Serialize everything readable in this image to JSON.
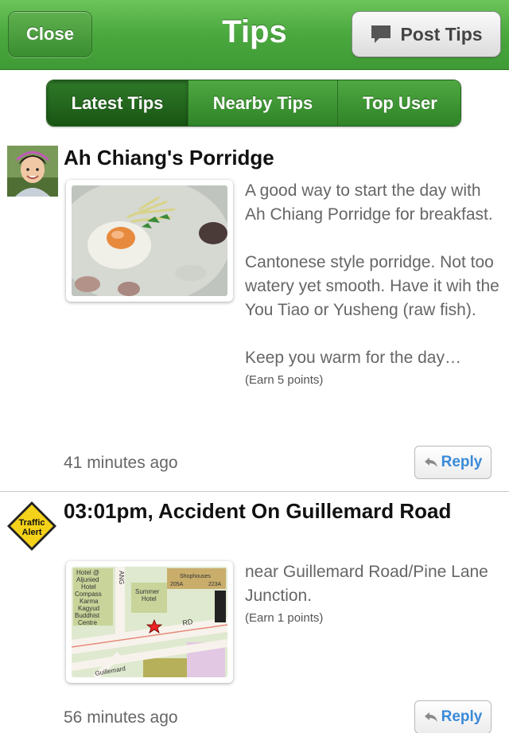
{
  "navbar": {
    "title": "Tips",
    "close_label": "Close",
    "post_label": "Post Tips"
  },
  "tabs": [
    {
      "label": "Latest Tips",
      "active": true
    },
    {
      "label": "Nearby Tips",
      "active": false
    },
    {
      "label": "Top User",
      "active": false
    }
  ],
  "tips": [
    {
      "title": "Ah Chiang's Porridge",
      "paragraphs": [
        "A good way to start the day with Ah Chiang Porridge for breakfast.",
        "Cantonese style porridge. Not too watery yet smooth. Have it wih the You Tiao or Yusheng (raw fish).",
        "Keep you warm for the day…"
      ],
      "earn": "(Earn 5 points)",
      "time": "41 minutes ago",
      "reply_label": "Reply",
      "icon": "user-avatar",
      "image": "porridge-photo"
    },
    {
      "title": "03:01pm, Accident On Guillemard Road",
      "paragraphs": [
        "near Guillemard Road/Pine Lane Junction."
      ],
      "earn": "(Earn 1 points)",
      "time": "56 minutes ago",
      "reply_label": "Reply",
      "icon": "traffic-alert-sign",
      "sign_text": [
        "Traffic",
        "Alert"
      ],
      "image": "map-thumbnail",
      "map_labels": {
        "hotel": [
          "Hotel @",
          "Aljunied",
          "Hotel"
        ],
        "summer": [
          "Summer",
          "Hotel"
        ],
        "shophouses": "Shophouses",
        "lot_a": "205A",
        "lot_b": "223A",
        "temple": [
          "Compass",
          "Karma",
          "Kagyud",
          "Buddhist",
          "Centre"
        ],
        "road": "RD",
        "lane": "ANG",
        "guillemard": "Guillemard"
      }
    }
  ],
  "colors": {
    "nav_green": "#4aa83e",
    "segment_active": "#195514",
    "reply_blue": "#3a8ad8",
    "alert_yellow": "#f4d21a"
  }
}
